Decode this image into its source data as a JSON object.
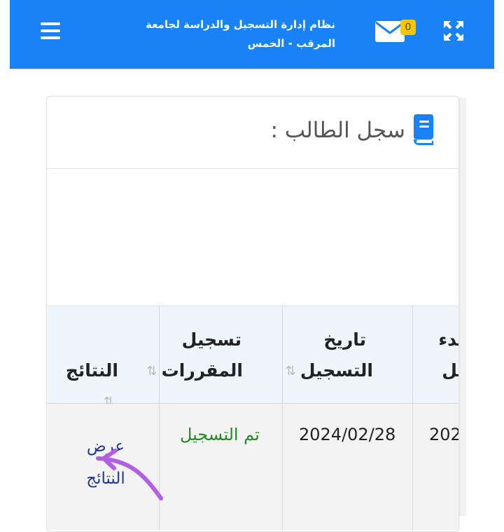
{
  "navbar": {
    "title": "نظام إدارة التسجيل والدراسة لجامعة المرقب - الخمس",
    "mail_count": "0",
    "icons": [
      "expand-icon",
      "mail-icon",
      "menu-icon"
    ],
    "color": "#1a82f7"
  },
  "card": {
    "title": "سجل الطالب :",
    "icon": "book-icon"
  },
  "table": {
    "headers": {
      "results": "النتائج",
      "course_registration": "تسجيل المقررات",
      "registration_date": "تاريخ التسجيل",
      "start": "بدء",
      "start_line2": "يل"
    },
    "row": {
      "results_link": "عرض النتائج",
      "course_status": "تم التسجيل",
      "registration_date": "2024/02/28",
      "start": "202"
    }
  }
}
